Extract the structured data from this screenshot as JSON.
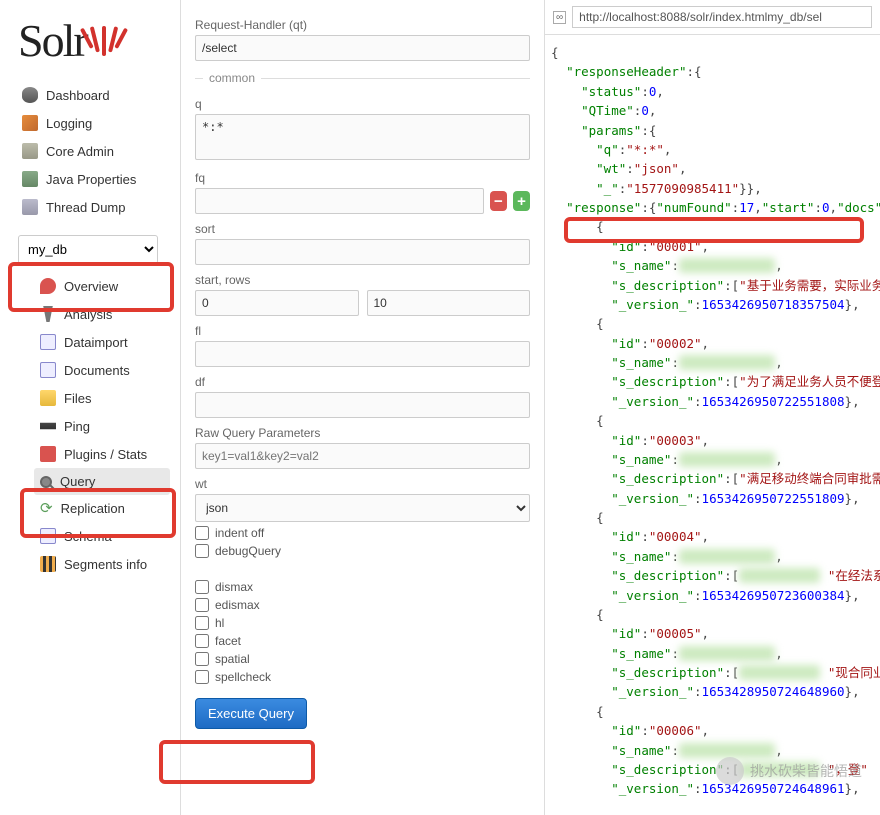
{
  "logo": {
    "text": "Solr"
  },
  "nav": [
    {
      "key": "dashboard",
      "label": "Dashboard",
      "icon": "i-dash"
    },
    {
      "key": "logging",
      "label": "Logging",
      "icon": "i-log"
    },
    {
      "key": "coreadmin",
      "label": "Core Admin",
      "icon": "i-core"
    },
    {
      "key": "javaprops",
      "label": "Java Properties",
      "icon": "i-java"
    },
    {
      "key": "threaddump",
      "label": "Thread Dump",
      "icon": "i-thread"
    }
  ],
  "core_selector": {
    "value": "my_db"
  },
  "subnav": [
    {
      "key": "overview",
      "label": "Overview",
      "icon": "i-overview"
    },
    {
      "key": "analysis",
      "label": "Analysis",
      "icon": "i-analysis"
    },
    {
      "key": "dataimport",
      "label": "Dataimport",
      "icon": "i-import"
    },
    {
      "key": "documents",
      "label": "Documents",
      "icon": "i-docs"
    },
    {
      "key": "files",
      "label": "Files",
      "icon": "i-files"
    },
    {
      "key": "ping",
      "label": "Ping",
      "icon": "i-ping"
    },
    {
      "key": "plugins",
      "label": "Plugins / Stats",
      "icon": "i-plugins"
    },
    {
      "key": "query",
      "label": "Query",
      "icon": "i-query",
      "selected": true
    },
    {
      "key": "replication",
      "label": "Replication",
      "icon": "i-repl",
      "glyph": "⟳"
    },
    {
      "key": "schema",
      "label": "Schema",
      "icon": "i-schema"
    },
    {
      "key": "segments",
      "label": "Segments info",
      "icon": "i-seg"
    }
  ],
  "query": {
    "rh_label": "Request-Handler (qt)",
    "rh_value": "/select",
    "common_legend": "common",
    "q_label": "q",
    "q_value": "*:*",
    "fq_label": "fq",
    "fq_value": "",
    "sort_label": "sort",
    "sort_value": "",
    "startrows_label": "start, rows",
    "start_value": "0",
    "rows_value": "10",
    "fl_label": "fl",
    "fl_value": "",
    "df_label": "df",
    "df_value": "",
    "raw_label": "Raw Query Parameters",
    "raw_placeholder": "key1=val1&key2=val2",
    "wt_label": "wt",
    "wt_value": "json",
    "checks": [
      "indent off",
      "debugQuery",
      "dismax",
      "edismax",
      "hl",
      "facet",
      "spatial",
      "spellcheck"
    ],
    "exec_label": "Execute Query"
  },
  "url": "http://localhost:8088/solr/index.htmlmy_db/sel",
  "response": {
    "responseHeader": {
      "status": 0,
      "QTime": 0,
      "params": {
        "q": "*:*",
        "wt": "json",
        "_": "1577090985411"
      }
    },
    "response": {
      "numFound": 17,
      "start": 0
    },
    "docs": [
      {
        "id": "00001",
        "s_description": "基于业务需要，实际业务中，",
        "version": "1653426950718357504"
      },
      {
        "id": "00002",
        "s_description": "为了满足业务人员不便登录经法",
        "version": "1653426950722551808"
      },
      {
        "id": "00003",
        "s_description": "满足移动终端合同审批需求，实",
        "version": "1653426950722551809"
      },
      {
        "id": "00004",
        "s_description": "在经法系统进行",
        "version": "1653426950723600384"
      },
      {
        "id": "00005",
        "s_description": "现合同业务可",
        "version": "1653428950724648960"
      },
      {
        "id": "00006",
        "s_description": "，登",
        "version": "1653426950724648961"
      }
    ]
  },
  "watermark": "挑水砍柴皆能悟道"
}
